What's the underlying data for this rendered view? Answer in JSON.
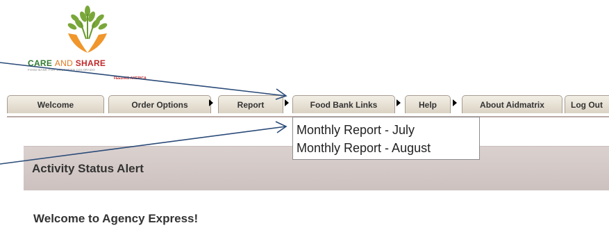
{
  "logo": {
    "care": "CARE",
    "and": "AND",
    "share": "SHARE",
    "tagline": "FOOD BANK FOR SOUTHERN COLORADO",
    "partner": "FEEDING AMERICA"
  },
  "nav": {
    "tabs": [
      {
        "label": "Welcome"
      },
      {
        "label": "Order Options"
      },
      {
        "label": "Report"
      },
      {
        "label": "Food Bank Links"
      },
      {
        "label": "Help"
      },
      {
        "label": "About Aidmatrix"
      },
      {
        "label": "Log Out"
      }
    ]
  },
  "dropdown": {
    "items": [
      "Monthly Report - July",
      "Monthly Report - August"
    ]
  },
  "content": {
    "alert_title": "Activity Status Alert",
    "welcome_heading": "Welcome to Agency Express!"
  },
  "colors": {
    "nav_border": "#b9a9a5",
    "alert_band": "#d3c8c6",
    "annotation_arrow": "#2b4b78"
  }
}
